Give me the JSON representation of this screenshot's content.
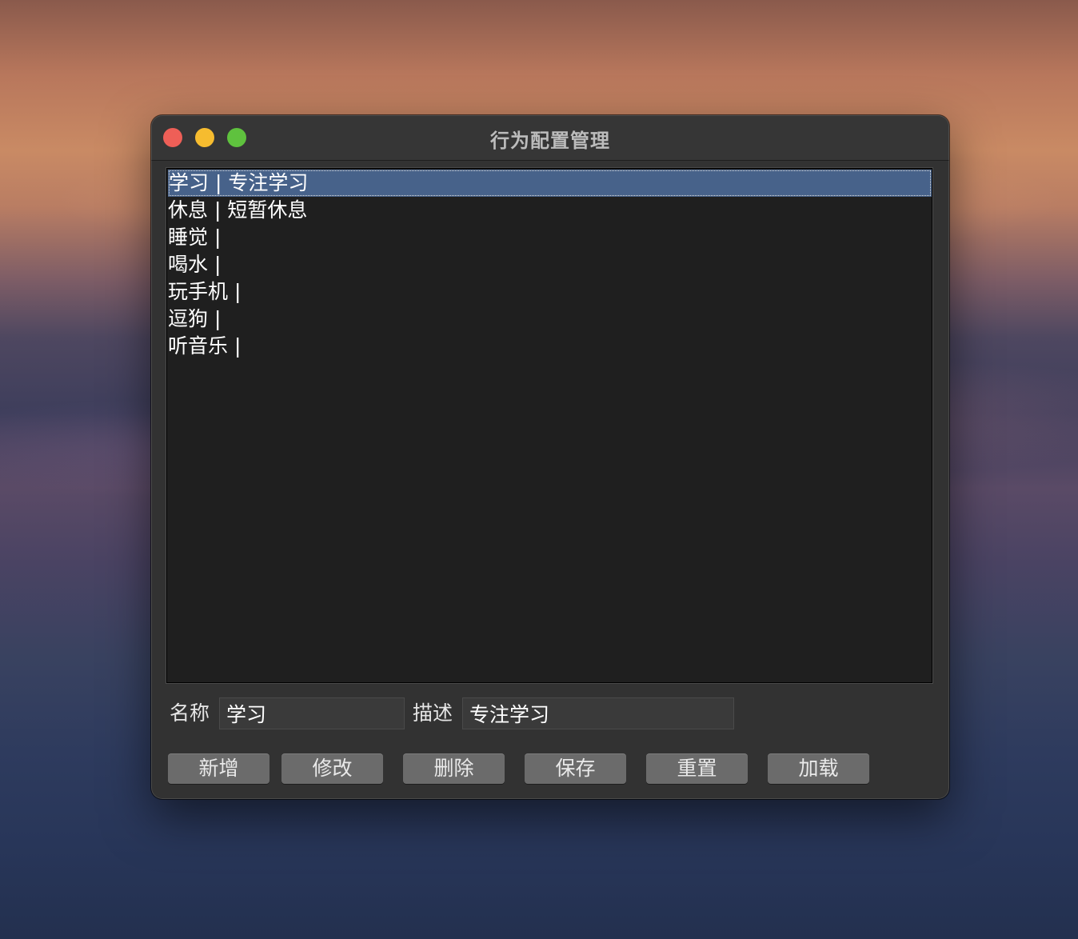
{
  "window": {
    "title": "行为配置管理"
  },
  "list": {
    "items": [
      {
        "label": "学习 | 专注学习",
        "selected": true
      },
      {
        "label": "休息 | 短暂休息",
        "selected": false
      },
      {
        "label": "睡觉 |",
        "selected": false
      },
      {
        "label": "喝水 |",
        "selected": false
      },
      {
        "label": "玩手机 |",
        "selected": false
      },
      {
        "label": "逗狗 |",
        "selected": false
      },
      {
        "label": "听音乐 |",
        "selected": false
      }
    ]
  },
  "form": {
    "name_label": "名称",
    "name_value": "学习",
    "desc_label": "描述",
    "desc_value": "专注学习"
  },
  "buttons": {
    "add": "新增",
    "edit": "修改",
    "delete": "删除",
    "save": "保存",
    "reset": "重置",
    "load": "加载"
  },
  "colors": {
    "window_bg": "#323232",
    "list_bg": "#1f1f1f",
    "selection": "#47628a",
    "button_bg": "#6b6b6b",
    "close": "#ee5f57",
    "minimize": "#f6bc2f",
    "maximize": "#5fc23e"
  }
}
